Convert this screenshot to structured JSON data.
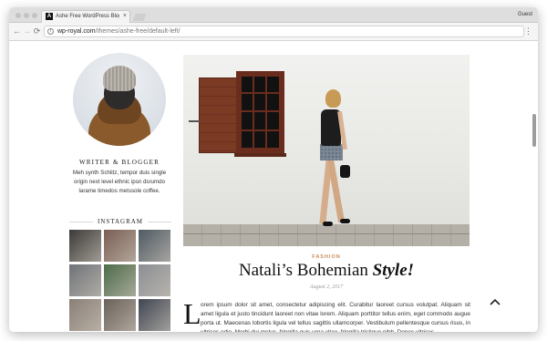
{
  "browser": {
    "tab_title": "Ashe Free WordPress Blog Th",
    "tab_favicon_letter": "A",
    "tab_close": "×",
    "profile": "Guest",
    "url_host": "wp-royal.com",
    "url_path": "/themes/ashe-free/default-left/",
    "back_icon": "←",
    "forward_icon": "→",
    "reload_icon": "⟳",
    "menu_icon": "⋮",
    "info_icon": "i"
  },
  "sidebar": {
    "role": "WRITER & BLOGGER",
    "bio": "Meh synth Schlitz, tempor duis single origin next level ethnic ipsn dsrumdo larame timedos metssole coffee.",
    "instagram_heading": "INSTAGRAM",
    "instagram_tiles": [
      "#3c3a38",
      "#7a5e53",
      "#4f5a63",
      "#6f7378",
      "#4d6b4a",
      "#8b8e93",
      "#8a7f76",
      "#6a625a",
      "#3f4652"
    ]
  },
  "post": {
    "category": "FASHION",
    "title_main": "Natali’s Bohemian ",
    "title_emphasis": "Style!",
    "date": "August 2, 2017",
    "drop_cap": "L",
    "excerpt": "orem ipsum dolor sit amet, consectetur adipiscing elit. Curabitur laoreet cursus volutpat. Aliquam sit amet ligula et justo tincidunt laoreet non vitae lorem. Aliquam porttitor tellus enim, eget commodo augue porta ut. Maecenas lobortis ligula vel tellus sagittis ullamcorper. Vestibulum pellentesque cursus risus, in ultrices odio. Morbi dui metus, fringilla quis urna vitae, fringilla tristique nibh. Donec ultrices"
  },
  "colors": {
    "accent": "#c98c58",
    "shutter": "#7b3a24"
  }
}
